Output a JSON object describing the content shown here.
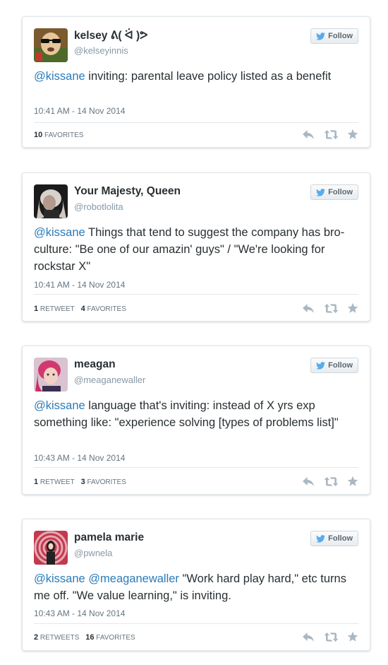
{
  "follow_label": "Follow",
  "tweets": [
    {
      "name": "kelsey ᕕ( ᐛ )ᕗ",
      "handle": "@kelseyinnis",
      "mention": "@kissane",
      "text": " inviting: parental leave policy listed as a benefit",
      "time": "10:41 AM - 14 Nov 2014",
      "favorites_count": "10",
      "favorites_label": "FAVORITES"
    },
    {
      "name": "Your Majesty, Queen",
      "handle": "@robotlolita",
      "mention": "@kissane",
      "text": " Things that tend to suggest the company has bro-culture: \"Be one of our amazin' guys\" / \"We're looking for rockstar X\"",
      "time": "10:41 AM - 14 Nov 2014",
      "retweets_count": "1",
      "retweets_label": "RETWEET",
      "favorites_count": "4",
      "favorites_label": "FAVORITES"
    },
    {
      "name": "meagan",
      "handle": "@meaganewaller",
      "mention": "@kissane",
      "text": " language that's inviting: instead of X yrs exp something like: \"experience solving [types of problems list]\"",
      "time": "10:43 AM - 14 Nov 2014",
      "retweets_count": "1",
      "retweets_label": "RETWEET",
      "favorites_count": "3",
      "favorites_label": "FAVORITES"
    },
    {
      "name": "pamela marie",
      "handle": "@pwnela",
      "mention": "@kissane @meaganewaller",
      "text": " \"Work hard play hard,\" etc turns me off. \"We value learning,\" is inviting.",
      "time": "10:43 AM - 14 Nov 2014",
      "retweets_count": "2",
      "retweets_label": "RETWEETS",
      "favorites_count": "16",
      "favorites_label": "FAVORITES"
    }
  ],
  "icons": {
    "bird": "twitter-bird-icon",
    "reply": "reply-icon",
    "retweet": "retweet-icon",
    "favorite": "star-icon"
  },
  "colors": {
    "link": "#2b7bb9",
    "bird": "#55acee",
    "action_icon": "#aab8c2",
    "meta_text": "#66757f"
  }
}
